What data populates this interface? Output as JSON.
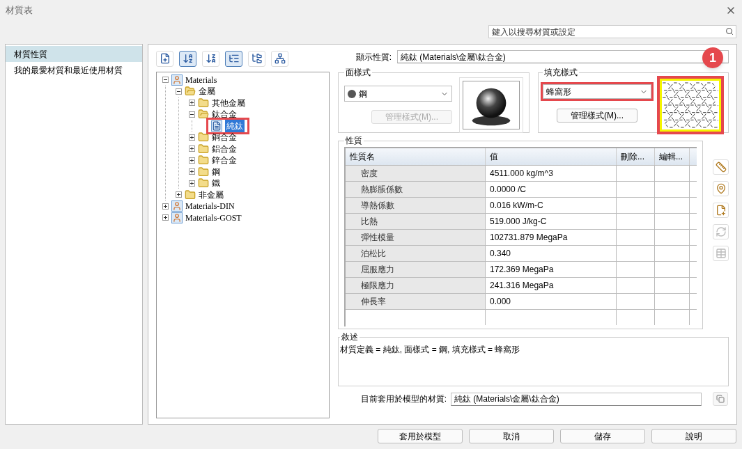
{
  "window": {
    "title": "材質表"
  },
  "search": {
    "placeholder": "鍵入以搜尋材質或設定"
  },
  "sidebar": {
    "items": [
      {
        "label": "材質性質",
        "selected": true
      },
      {
        "label": "我的最愛材質和最近使用材質",
        "selected": false
      }
    ]
  },
  "toolbar": [
    {
      "kind": "new",
      "pressed": false
    },
    {
      "kind": "sort_az",
      "pressed": true
    },
    {
      "kind": "sort_za",
      "pressed": false
    },
    {
      "kind": "tree_view",
      "pressed": true
    },
    {
      "kind": "folder_view",
      "pressed": false
    },
    {
      "kind": "list_view",
      "pressed": false
    }
  ],
  "tree": [
    {
      "label": "Materials",
      "kind": "library",
      "expanded": true,
      "selected": false,
      "highlighted": false,
      "children": [
        {
          "label": "金屬",
          "kind": "folder",
          "expanded": true,
          "selected": false,
          "highlighted": false,
          "children": [
            {
              "label": "其他金屬",
              "kind": "folder",
              "expanded": false,
              "selected": false,
              "highlighted": false
            },
            {
              "label": "鈦合金",
              "kind": "folder",
              "expanded": true,
              "selected": false,
              "highlighted": false,
              "children": [
                {
                  "label": "純鈦",
                  "kind": "material",
                  "selected": true,
                  "highlighted": true
                }
              ]
            },
            {
              "label": "銅合金",
              "kind": "folder",
              "expanded": false,
              "selected": false,
              "highlighted": false
            },
            {
              "label": "鋁合金",
              "kind": "folder",
              "expanded": false,
              "selected": false,
              "highlighted": false
            },
            {
              "label": "鋅合金",
              "kind": "folder",
              "expanded": false,
              "selected": false,
              "highlighted": false
            },
            {
              "label": "鋼",
              "kind": "folder",
              "expanded": false,
              "selected": false,
              "highlighted": false
            },
            {
              "label": "鐵",
              "kind": "folder",
              "expanded": false,
              "selected": false,
              "highlighted": false
            }
          ]
        },
        {
          "label": "非金屬",
          "kind": "folder",
          "expanded": false,
          "selected": false,
          "highlighted": false
        }
      ]
    },
    {
      "label": "Materials-DIN",
      "kind": "library",
      "expanded": false,
      "selected": false,
      "highlighted": false
    },
    {
      "label": "Materials-GOST",
      "kind": "library",
      "expanded": false,
      "selected": false,
      "highlighted": false
    }
  ],
  "display": {
    "label": "顯示性質:",
    "value": "純鈦 (Materials\\金屬\\鈦合金)"
  },
  "face_style": {
    "title": "面樣式",
    "selected": "鋼",
    "button": "管理樣式(M)...",
    "button_disabled": true
  },
  "fill_style": {
    "title": "填充樣式",
    "selected": "蜂窩形",
    "button": "管理樣式(M)...",
    "button_disabled": false,
    "highlighted": true,
    "preview_highlighted": true
  },
  "callout": {
    "label": "1"
  },
  "properties": {
    "title": "性質",
    "columns": [
      "性質名",
      "值",
      "刪除...",
      "編輯..."
    ],
    "rows": [
      {
        "name": "密度",
        "value": "4511.000 kg/m^3"
      },
      {
        "name": "熱膨脹係數",
        "value": "0.0000 /C"
      },
      {
        "name": "導熱係數",
        "value": "0.016 kW/m-C"
      },
      {
        "name": "比熱",
        "value": "519.000 J/kg-C"
      },
      {
        "name": "彈性模量",
        "value": "102731.879 MegaPa"
      },
      {
        "name": "泊松比",
        "value": "0.340"
      },
      {
        "name": "屈服應力",
        "value": "172.369 MegaPa"
      },
      {
        "name": "極限應力",
        "value": "241.316 MegaPa"
      },
      {
        "name": "伸長率",
        "value": "0.000"
      }
    ]
  },
  "side_tools": [
    {
      "kind": "units",
      "disabled": false
    },
    {
      "kind": "map",
      "disabled": false
    },
    {
      "kind": "add",
      "disabled": false
    },
    {
      "kind": "sync",
      "disabled": true
    },
    {
      "kind": "table",
      "disabled": true
    }
  ],
  "description": {
    "title": "敘述",
    "text": "材質定義 = 純鈦, 面樣式 = 鋼, 填充樣式 = 蜂窩形"
  },
  "current": {
    "label": "目前套用於模型的材質:",
    "value": "純鈦 (Materials\\金屬\\鈦合金)"
  },
  "buttons": [
    "套用於模型",
    "取消",
    "儲存",
    "說明"
  ]
}
